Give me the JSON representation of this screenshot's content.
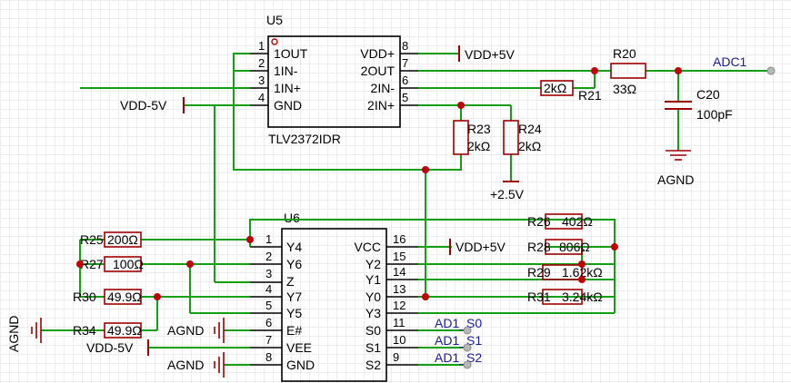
{
  "u5": {
    "ref": "U5",
    "part": "TLV2372IDR",
    "pins_left": [
      {
        "num": "1",
        "name": "1OUT"
      },
      {
        "num": "2",
        "name": "1IN-"
      },
      {
        "num": "3",
        "name": "1IN+"
      },
      {
        "num": "4",
        "name": "GND"
      }
    ],
    "pins_right": [
      {
        "num": "8",
        "name": "VDD+"
      },
      {
        "num": "7",
        "name": "2OUT"
      },
      {
        "num": "6",
        "name": "2IN-"
      },
      {
        "num": "5",
        "name": "2IN+"
      }
    ]
  },
  "u6": {
    "ref": "U6",
    "pins_left": [
      {
        "num": "1",
        "name": "Y4"
      },
      {
        "num": "2",
        "name": "Y6"
      },
      {
        "num": "3",
        "name": "Z"
      },
      {
        "num": "4",
        "name": "Y7"
      },
      {
        "num": "5",
        "name": "Y5"
      },
      {
        "num": "6",
        "name": "E#"
      },
      {
        "num": "7",
        "name": "VEE"
      },
      {
        "num": "8",
        "name": "GND"
      }
    ],
    "pins_right": [
      {
        "num": "16",
        "name": "VCC"
      },
      {
        "num": "15",
        "name": "Y2"
      },
      {
        "num": "14",
        "name": "Y1"
      },
      {
        "num": "13",
        "name": "Y0"
      },
      {
        "num": "12",
        "name": "Y3"
      },
      {
        "num": "11",
        "name": "S0"
      },
      {
        "num": "10",
        "name": "S1"
      },
      {
        "num": "9",
        "name": "S2"
      }
    ]
  },
  "resistors": {
    "r20": {
      "ref": "R20",
      "value": "33Ω"
    },
    "r21": {
      "ref": "R21",
      "value": "2kΩ"
    },
    "r23": {
      "ref": "R23",
      "value": "2kΩ"
    },
    "r24": {
      "ref": "R24",
      "value": "2kΩ"
    },
    "r25": {
      "ref": "R25",
      "value": "200Ω"
    },
    "r27": {
      "ref": "R27",
      "value": "100Ω"
    },
    "r30": {
      "ref": "R30",
      "value": "49.9Ω"
    },
    "r34": {
      "ref": "R34",
      "value": "49.9Ω"
    },
    "r26": {
      "ref": "R26",
      "value": "402Ω"
    },
    "r28": {
      "ref": "R28",
      "value": "806Ω"
    },
    "r29": {
      "ref": "R29",
      "value": "1.62kΩ"
    },
    "r31": {
      "ref": "R31",
      "value": "3.24kΩ"
    }
  },
  "c20": {
    "ref": "C20",
    "value": "100pF"
  },
  "nets": {
    "vdd_p5_top": "VDD+5V",
    "vdd_m5_top": "VDD-5V",
    "adc1": "ADC1",
    "agnd_c20": "AGND",
    "vref": "+2.5V",
    "vdd_p5_u6": "VDD+5V",
    "agnd_left": "AGND",
    "agnd_e": "AGND",
    "vdd_m5_u6": "VDD-5V",
    "agnd_gnd": "AGND",
    "s0": "AD1_S0",
    "s1": "AD1_S1",
    "s2": "AD1_S2"
  }
}
